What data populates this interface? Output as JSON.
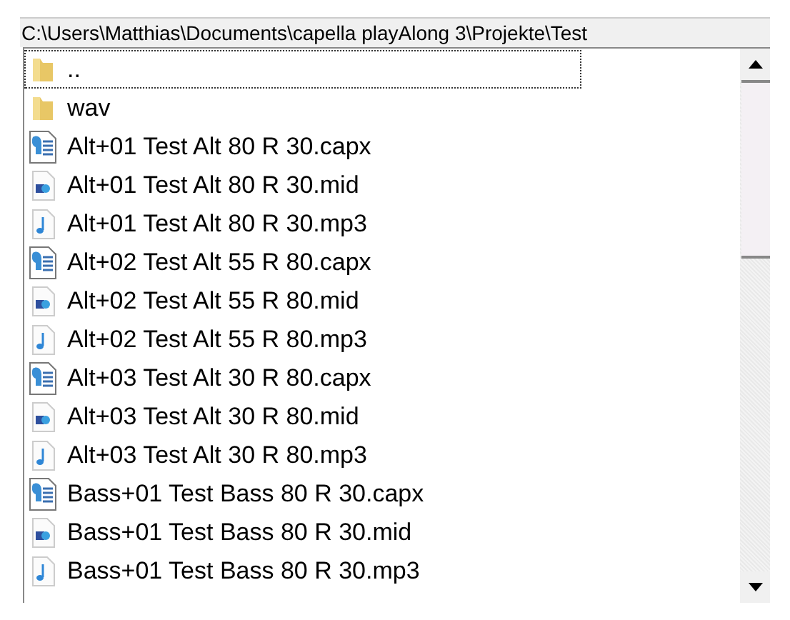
{
  "path": "C:\\Users\\Matthias\\Documents\\capella playAlong 3\\Projekte\\Test",
  "files": [
    {
      "name": "..",
      "kind": "folder",
      "focused": true
    },
    {
      "name": "wav",
      "kind": "folder",
      "focused": false
    },
    {
      "name": "Alt+01 Test Alt 80 R 30.capx",
      "kind": "capx",
      "focused": false
    },
    {
      "name": "Alt+01 Test Alt 80 R 30.mid",
      "kind": "mid",
      "focused": false
    },
    {
      "name": "Alt+01 Test Alt 80 R 30.mp3",
      "kind": "mp3",
      "focused": false
    },
    {
      "name": "Alt+02 Test Alt 55 R 80.capx",
      "kind": "capx",
      "focused": false
    },
    {
      "name": "Alt+02 Test Alt 55 R 80.mid",
      "kind": "mid",
      "focused": false
    },
    {
      "name": "Alt+02 Test Alt 55 R 80.mp3",
      "kind": "mp3",
      "focused": false
    },
    {
      "name": "Alt+03 Test Alt 30 R 80.capx",
      "kind": "capx",
      "focused": false
    },
    {
      "name": "Alt+03 Test Alt 30 R 80.mid",
      "kind": "mid",
      "focused": false
    },
    {
      "name": "Alt+03 Test Alt 30 R 80.mp3",
      "kind": "mp3",
      "focused": false
    },
    {
      "name": "Bass+01 Test Bass 80 R 30.capx",
      "kind": "capx",
      "focused": false
    },
    {
      "name": "Bass+01 Test Bass 80 R 30.mid",
      "kind": "mid",
      "focused": false
    },
    {
      "name": "Bass+01 Test Bass 80 R 30.mp3",
      "kind": "mp3",
      "focused": false
    }
  ]
}
